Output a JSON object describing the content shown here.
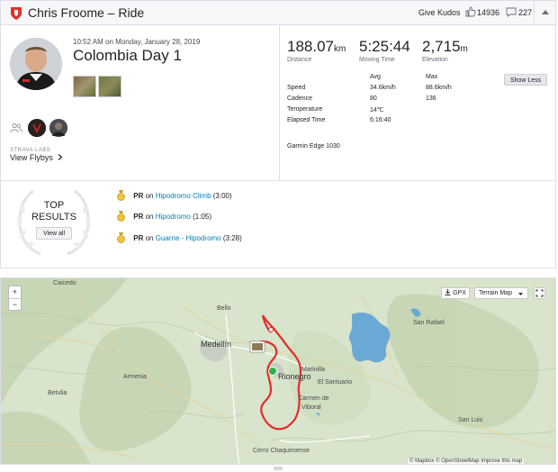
{
  "header": {
    "athlete_activity": "Chris Froome – Ride",
    "give_kudos": "Give Kudos",
    "kudos_count": "14936",
    "comment_count": "227"
  },
  "activity": {
    "datetime": "10:52 AM on Monday, January 28, 2019",
    "title": "Colombia Day 1"
  },
  "flyby": {
    "brand": "STRAVA LABS",
    "link": "View Flybys"
  },
  "stats": [
    {
      "value": "188.07",
      "unit": "km",
      "label": "Distance"
    },
    {
      "value": "5:25:44",
      "unit": "",
      "label": "Moving Time"
    },
    {
      "value": "2,715",
      "unit": "m",
      "label": "Elevation"
    }
  ],
  "details": {
    "col_avg": "Avg",
    "col_max": "Max",
    "rows": [
      {
        "label": "Speed",
        "avg": "34.6km/h",
        "max": "88.6km/h"
      },
      {
        "label": "Cadence",
        "avg": "80",
        "max": "136"
      },
      {
        "label": "Temperature",
        "avg": "14℃",
        "max": ""
      },
      {
        "label": "Elapsed Time",
        "avg": "6:16:40",
        "max": ""
      }
    ],
    "show_less": "Show Less",
    "device": "Garmin Edge 1030"
  },
  "top_results": {
    "line1": "TOP",
    "line2": "RESULTS",
    "view_all": "View all",
    "items": [
      {
        "badge": "PR",
        "on": "on",
        "segment": "Hipodromo Climb",
        "time": "(3:00)"
      },
      {
        "badge": "PR",
        "on": "on",
        "segment": "Hipodromo",
        "time": "(1:05)"
      },
      {
        "badge": "PR",
        "on": "on",
        "segment": "Guarne - Hipodromo",
        "time": "(3:28)"
      }
    ]
  },
  "map": {
    "zoom_in": "+",
    "zoom_out": "−",
    "gpx": "GPX",
    "terrain": "Terrain Map",
    "attribution": "© Mapbox © OpenStreetMap Improve this map",
    "places": {
      "medellin": "Medellín",
      "rionegro": "Rionegro",
      "marinilla": "Marinilla",
      "el_santuario": "El Santuario",
      "carmen": "Carmen de",
      "viboral": "Viboral",
      "bello": "Bello",
      "san_rafael": "San Rafael",
      "san_luis": "San Luis",
      "betulia": "Betulia",
      "armenia": "Armenia",
      "cerro": "Cerro Chaquiroense",
      "caicedo": "Caicedo"
    }
  },
  "colors": {
    "accent": "#fc4c02",
    "link": "#007fb6",
    "route": "#e32b2b"
  }
}
